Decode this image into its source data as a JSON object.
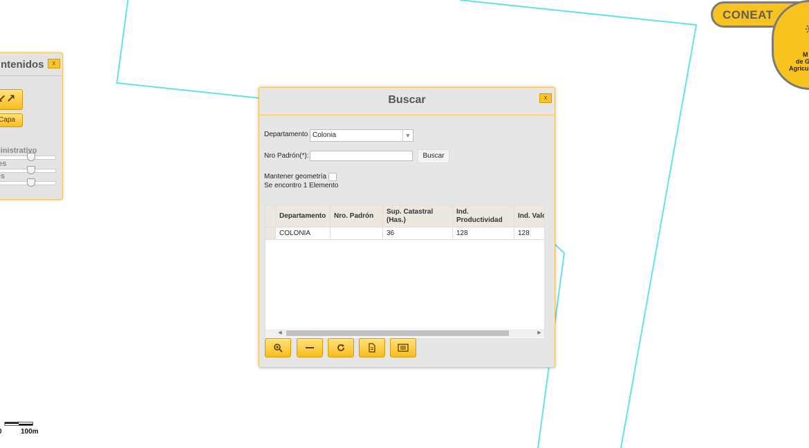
{
  "side_panel": {
    "title": "ntenidos",
    "close_label": "x",
    "capa_label": "Capa",
    "layers": [
      "ministrativo",
      "ces",
      "los"
    ]
  },
  "dialog": {
    "title": "Buscar",
    "close_label": "x",
    "departamento_label": "Departamento",
    "departamento_value": "Colonia",
    "padron_label": "Nro Padrón(*):",
    "padron_value": "",
    "buscar_label": "Buscar",
    "mantener_label": "Mantener geometría",
    "result_text": "Se encontro 1 Elemento"
  },
  "grid": {
    "columns": [
      "Departamento",
      "Nro. Padrón",
      "Sup. Catastral (Has.)",
      "Ind. Productividad",
      "Ind. Valo"
    ],
    "rows": [
      [
        "COLONIA",
        "",
        "36",
        "128",
        "128"
      ]
    ]
  },
  "toolbar": {
    "tools": [
      "zoom-icon",
      "minus-icon",
      "refresh-icon",
      "document-icon",
      "list-icon"
    ]
  },
  "badge": {
    "coneat": "CONEAT",
    "ministry_lines": [
      "M",
      "de G",
      "Agricul"
    ]
  },
  "scale": {
    "left_label": "0",
    "right_label": "100m"
  },
  "colors": {
    "accent": "#f9c31f",
    "map_line": "#5fe3e8"
  }
}
